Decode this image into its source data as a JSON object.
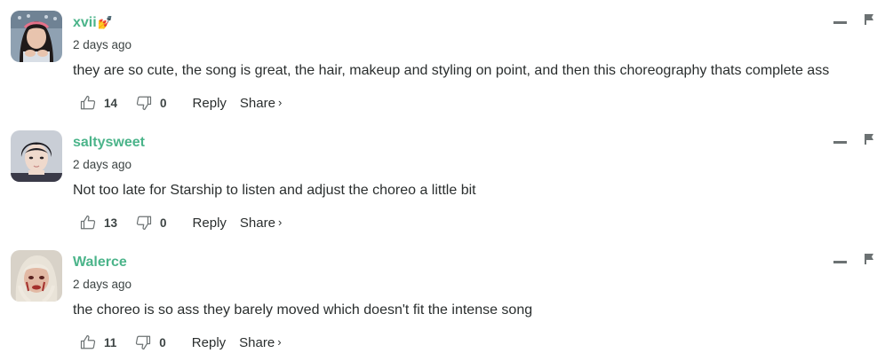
{
  "comments": [
    {
      "username": "xvii",
      "badge": "💅",
      "timestamp": "2 days ago",
      "text": "they are so cute, the song is great, the hair, makeup and styling on point, and then this choreography thats complete ass",
      "upvotes": "14",
      "downvotes": "0",
      "reply_label": "Reply",
      "share_label": "Share",
      "share_chevron": "›"
    },
    {
      "username": "saltysweet",
      "badge": "",
      "timestamp": "2 days ago",
      "text": "Not too late for Starship to listen and adjust the choreo a little bit",
      "upvotes": "13",
      "downvotes": "0",
      "reply_label": "Reply",
      "share_label": "Share",
      "share_chevron": "›"
    },
    {
      "username": "Walerce",
      "badge": "",
      "timestamp": "2 days ago",
      "text": "the choreo is so ass they barely moved which doesn't fit the intense song",
      "upvotes": "11",
      "downvotes": "0",
      "reply_label": "Reply",
      "share_label": "Share",
      "share_chevron": "›"
    }
  ],
  "icons": {
    "upvote": "thumbs-up-icon",
    "downvote": "thumbs-down-icon",
    "minimize": "minimize-icon",
    "flag": "flag-icon"
  },
  "colors": {
    "username": "#4bb48a",
    "text": "#2a2e2e",
    "icon": "#6c7273"
  }
}
